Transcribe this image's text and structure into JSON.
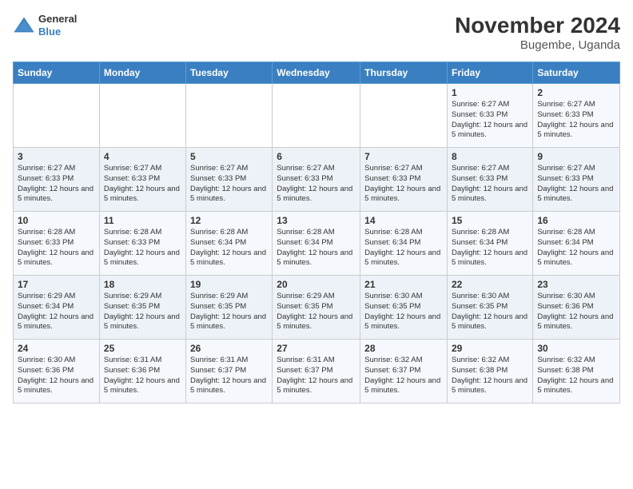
{
  "logo": {
    "general": "General",
    "blue": "Blue"
  },
  "title": "November 2024",
  "subtitle": "Bugembe, Uganda",
  "days_of_week": [
    "Sunday",
    "Monday",
    "Tuesday",
    "Wednesday",
    "Thursday",
    "Friday",
    "Saturday"
  ],
  "weeks": [
    [
      {
        "day": "",
        "info": ""
      },
      {
        "day": "",
        "info": ""
      },
      {
        "day": "",
        "info": ""
      },
      {
        "day": "",
        "info": ""
      },
      {
        "day": "",
        "info": ""
      },
      {
        "day": "1",
        "info": "Sunrise: 6:27 AM\nSunset: 6:33 PM\nDaylight: 12 hours and 5 minutes."
      },
      {
        "day": "2",
        "info": "Sunrise: 6:27 AM\nSunset: 6:33 PM\nDaylight: 12 hours and 5 minutes."
      }
    ],
    [
      {
        "day": "3",
        "info": "Sunrise: 6:27 AM\nSunset: 6:33 PM\nDaylight: 12 hours and 5 minutes."
      },
      {
        "day": "4",
        "info": "Sunrise: 6:27 AM\nSunset: 6:33 PM\nDaylight: 12 hours and 5 minutes."
      },
      {
        "day": "5",
        "info": "Sunrise: 6:27 AM\nSunset: 6:33 PM\nDaylight: 12 hours and 5 minutes."
      },
      {
        "day": "6",
        "info": "Sunrise: 6:27 AM\nSunset: 6:33 PM\nDaylight: 12 hours and 5 minutes."
      },
      {
        "day": "7",
        "info": "Sunrise: 6:27 AM\nSunset: 6:33 PM\nDaylight: 12 hours and 5 minutes."
      },
      {
        "day": "8",
        "info": "Sunrise: 6:27 AM\nSunset: 6:33 PM\nDaylight: 12 hours and 5 minutes."
      },
      {
        "day": "9",
        "info": "Sunrise: 6:27 AM\nSunset: 6:33 PM\nDaylight: 12 hours and 5 minutes."
      }
    ],
    [
      {
        "day": "10",
        "info": "Sunrise: 6:28 AM\nSunset: 6:33 PM\nDaylight: 12 hours and 5 minutes."
      },
      {
        "day": "11",
        "info": "Sunrise: 6:28 AM\nSunset: 6:33 PM\nDaylight: 12 hours and 5 minutes."
      },
      {
        "day": "12",
        "info": "Sunrise: 6:28 AM\nSunset: 6:34 PM\nDaylight: 12 hours and 5 minutes."
      },
      {
        "day": "13",
        "info": "Sunrise: 6:28 AM\nSunset: 6:34 PM\nDaylight: 12 hours and 5 minutes."
      },
      {
        "day": "14",
        "info": "Sunrise: 6:28 AM\nSunset: 6:34 PM\nDaylight: 12 hours and 5 minutes."
      },
      {
        "day": "15",
        "info": "Sunrise: 6:28 AM\nSunset: 6:34 PM\nDaylight: 12 hours and 5 minutes."
      },
      {
        "day": "16",
        "info": "Sunrise: 6:28 AM\nSunset: 6:34 PM\nDaylight: 12 hours and 5 minutes."
      }
    ],
    [
      {
        "day": "17",
        "info": "Sunrise: 6:29 AM\nSunset: 6:34 PM\nDaylight: 12 hours and 5 minutes."
      },
      {
        "day": "18",
        "info": "Sunrise: 6:29 AM\nSunset: 6:35 PM\nDaylight: 12 hours and 5 minutes."
      },
      {
        "day": "19",
        "info": "Sunrise: 6:29 AM\nSunset: 6:35 PM\nDaylight: 12 hours and 5 minutes."
      },
      {
        "day": "20",
        "info": "Sunrise: 6:29 AM\nSunset: 6:35 PM\nDaylight: 12 hours and 5 minutes."
      },
      {
        "day": "21",
        "info": "Sunrise: 6:30 AM\nSunset: 6:35 PM\nDaylight: 12 hours and 5 minutes."
      },
      {
        "day": "22",
        "info": "Sunrise: 6:30 AM\nSunset: 6:35 PM\nDaylight: 12 hours and 5 minutes."
      },
      {
        "day": "23",
        "info": "Sunrise: 6:30 AM\nSunset: 6:36 PM\nDaylight: 12 hours and 5 minutes."
      }
    ],
    [
      {
        "day": "24",
        "info": "Sunrise: 6:30 AM\nSunset: 6:36 PM\nDaylight: 12 hours and 5 minutes."
      },
      {
        "day": "25",
        "info": "Sunrise: 6:31 AM\nSunset: 6:36 PM\nDaylight: 12 hours and 5 minutes."
      },
      {
        "day": "26",
        "info": "Sunrise: 6:31 AM\nSunset: 6:37 PM\nDaylight: 12 hours and 5 minutes."
      },
      {
        "day": "27",
        "info": "Sunrise: 6:31 AM\nSunset: 6:37 PM\nDaylight: 12 hours and 5 minutes."
      },
      {
        "day": "28",
        "info": "Sunrise: 6:32 AM\nSunset: 6:37 PM\nDaylight: 12 hours and 5 minutes."
      },
      {
        "day": "29",
        "info": "Sunrise: 6:32 AM\nSunset: 6:38 PM\nDaylight: 12 hours and 5 minutes."
      },
      {
        "day": "30",
        "info": "Sunrise: 6:32 AM\nSunset: 6:38 PM\nDaylight: 12 hours and 5 minutes."
      }
    ]
  ]
}
